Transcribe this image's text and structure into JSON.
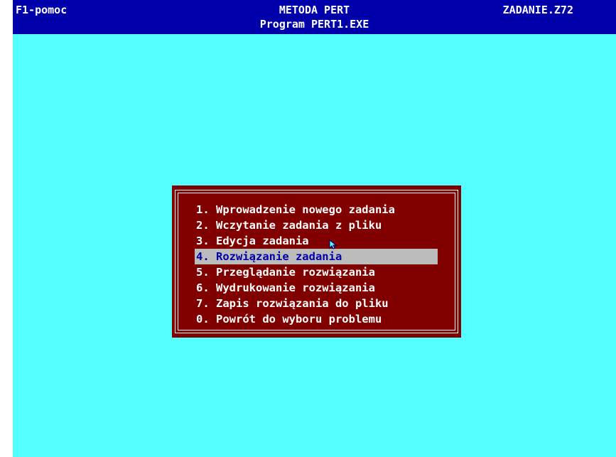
{
  "header": {
    "help_label": "F1-pomoc",
    "title": "METODA PERT",
    "subtitle": "Program PERT1.EXE",
    "task_label": "ZADANIE.Z72"
  },
  "menu": {
    "selected_index": 3,
    "items": [
      {
        "label": "1. Wprowadzenie nowego zadania"
      },
      {
        "label": "2. Wczytanie zadania z pliku"
      },
      {
        "label": "3. Edycja zadania"
      },
      {
        "label": "4. Rozwiązanie zadania"
      },
      {
        "label": "5. Przeglądanie rozwiązania"
      },
      {
        "label": "6. Wydrukowanie rozwiązania"
      },
      {
        "label": "7. Zapis rozwiązania do pliku"
      },
      {
        "label": "0. Powrót do wyboru problemu"
      }
    ]
  },
  "colors": {
    "background": "#55ffff",
    "header_bg": "#0000aa",
    "menu_bg": "#800000",
    "selection_bg": "#bcbcbc",
    "selection_fg": "#0000aa",
    "text": "#ffffff"
  },
  "icons": {
    "pointer": "mouse-cursor-icon"
  }
}
